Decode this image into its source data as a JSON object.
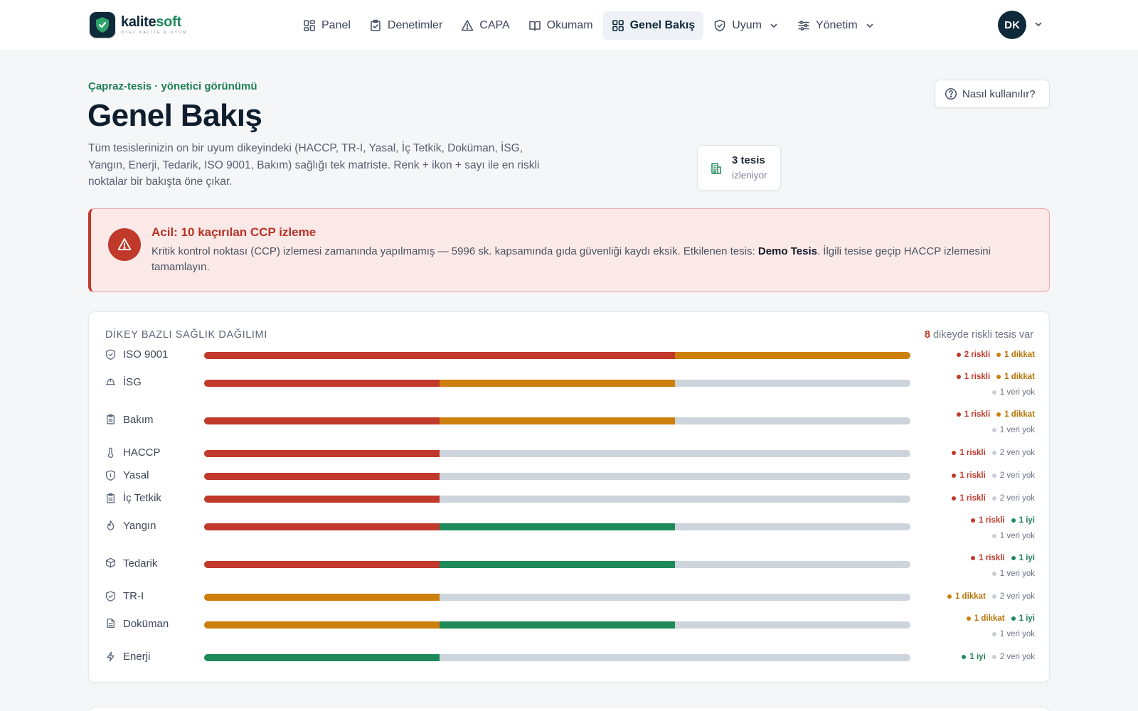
{
  "brand": {
    "name_a": "kalite",
    "name_b": "soft",
    "tagline": "OTEL KALİTE & UYUM"
  },
  "nav": {
    "items": [
      {
        "label": "Panel",
        "icon": "grid-icon",
        "active": false
      },
      {
        "label": "Denetimler",
        "icon": "clipboard-check-icon",
        "active": false
      },
      {
        "label": "CAPA",
        "icon": "warning-triangle-icon",
        "active": false
      },
      {
        "label": "Okumam",
        "icon": "book-icon",
        "active": false
      },
      {
        "label": "Genel Bakış",
        "icon": "grid-icon",
        "active": true
      },
      {
        "label": "Uyum",
        "icon": "shield-check-icon",
        "active": false,
        "dropdown": true
      },
      {
        "label": "Yönetim",
        "icon": "sliders-icon",
        "active": false,
        "dropdown": true
      }
    ],
    "user_initials": "DK"
  },
  "header": {
    "eyebrow": "Çapraz-tesis · yönetici görünümü",
    "title": "Genel Bakış",
    "description": "Tüm tesislerinizin on bir uyum dikeyindeki (HACCP, TR-I, Yasal, İç Tetkik, Doküman, İSG, Yangın, Enerji, Tedarik, ISO 9001, Bakım) sağlığı tek matriste. Renk + ikon + sayı ile en riskli noktalar bir bakışta öne çıkar.",
    "help_label": "Nasıl kullanılır?",
    "facility_count": "3 tesis",
    "facility_label": "izleniyor"
  },
  "alert": {
    "title": "Acil: 10 kaçırılan CCP izleme",
    "body_before": "Kritik kontrol noktası (CCP) izlemesi zamanında yapılmamış — 5996 sk. kapsamında gıda güvenliği kaydı eksik. Etkilenen tesis: ",
    "facility": "Demo Tesis",
    "body_after": ". İlgili tesise geçip HACCP izlemesini tamamlayın."
  },
  "health": {
    "title": "DİKEY BAZLI SAĞLIK DAĞILIMI",
    "note_count": "8",
    "note_text": " dikeyde riskli tesis var",
    "colors": {
      "riskli": "#c0392b",
      "dikkat": "#cc7f0d",
      "iyi": "#1e8a5a",
      "veri_yok": "#cdd4dc"
    },
    "rows": [
      {
        "name": "ISO 9001",
        "icon": "shield-check-icon",
        "riskli": 2,
        "dikkat": 1,
        "iyi": 0,
        "veri_yok": 0
      },
      {
        "name": "İSG",
        "icon": "hard-hat-icon",
        "riskli": 1,
        "dikkat": 1,
        "iyi": 0,
        "veri_yok": 1
      },
      {
        "name": "Bakım",
        "icon": "clipboard-icon",
        "riskli": 1,
        "dikkat": 1,
        "iyi": 0,
        "veri_yok": 1
      },
      {
        "name": "HACCP",
        "icon": "thermometer-icon",
        "riskli": 1,
        "dikkat": 0,
        "iyi": 0,
        "veri_yok": 2
      },
      {
        "name": "Yasal",
        "icon": "shield-icon",
        "riskli": 1,
        "dikkat": 0,
        "iyi": 0,
        "veri_yok": 2
      },
      {
        "name": "İç Tetkik",
        "icon": "clipboard-icon",
        "riskli": 1,
        "dikkat": 0,
        "iyi": 0,
        "veri_yok": 2
      },
      {
        "name": "Yangın",
        "icon": "flame-icon",
        "riskli": 1,
        "dikkat": 0,
        "iyi": 1,
        "veri_yok": 1
      },
      {
        "name": "Tedarik",
        "icon": "package-icon",
        "riskli": 1,
        "dikkat": 0,
        "iyi": 1,
        "veri_yok": 1
      },
      {
        "name": "TR-I",
        "icon": "shield-check-icon",
        "riskli": 0,
        "dikkat": 1,
        "iyi": 0,
        "veri_yok": 2
      },
      {
        "name": "Doküman",
        "icon": "file-icon",
        "riskli": 0,
        "dikkat": 1,
        "iyi": 1,
        "veri_yok": 1
      },
      {
        "name": "Enerji",
        "icon": "lightning-icon",
        "riskli": 0,
        "dikkat": 0,
        "iyi": 1,
        "veri_yok": 2
      }
    ],
    "legend_words": {
      "riskli": "riskli",
      "dikkat": "dikkat",
      "iyi": "iyi",
      "veri_yok": "veri yok"
    }
  }
}
